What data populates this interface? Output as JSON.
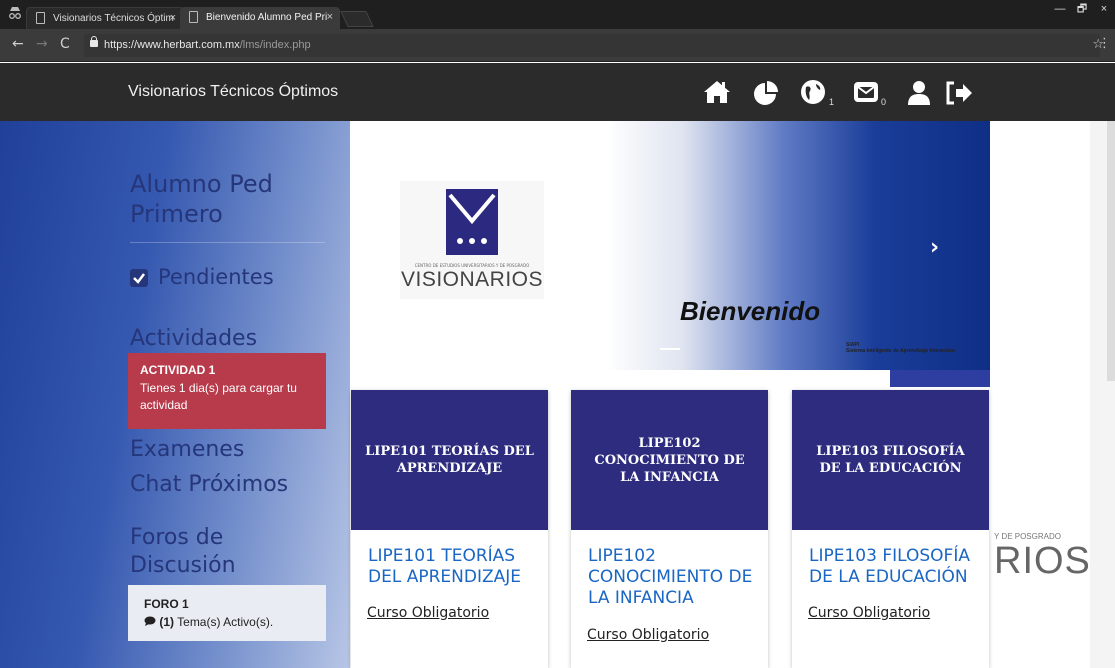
{
  "browser": {
    "tabs": [
      {
        "title": "Visionarios Técnicos Óptim",
        "active": false
      },
      {
        "title": "Bienvenido Alumno Ped Pri",
        "active": true
      }
    ],
    "url_host": "https://www.herbart.com.mx",
    "url_path": "/lms/index.php",
    "window_controls": {
      "minimize": "—",
      "restore": "🗗",
      "close": "×"
    },
    "tab_close": "×"
  },
  "header": {
    "brand": "Visionarios Técnicos Óptimos",
    "globe_count": "1",
    "mail_count": "0",
    "icons": [
      "home-icon",
      "pie-chart-icon",
      "globe-icon",
      "envelope-icon",
      "user-icon",
      "sign-out-icon"
    ]
  },
  "sidebar": {
    "student_name": "Alumno Ped Primero",
    "pendientes_label": "Pendientes",
    "actividades_heading": "Actividades",
    "activity_alert": {
      "title": "ACTIVIDAD 1",
      "message": "Tienes 1 dia(s) para cargar tu actividad"
    },
    "examenes_label": "Examenes",
    "chat_label": "Chat Próximos",
    "foros_heading": "Foros de Discusión",
    "forum": {
      "title": "FORO 1",
      "count": "(1)",
      "message": "Tema(s) Activo(s)."
    }
  },
  "carousel": {
    "logo_text": "VISIONARIOS",
    "logo_subtext": "CENTRO DE ESTUDIOS UNIVERSITARIOS Y DE POSGRADO",
    "welcome": "Bienvenido",
    "siap_title": "SIAPI",
    "siap_subtitle": "Sistema Inteligente de Aprendizaje Interactivo",
    "next_arrow": "›"
  },
  "background_partial": {
    "grado_text": "Y DE POSGRADO",
    "visionarios_partial": "RIOS"
  },
  "courses": [
    {
      "header": "LIPE101 TEORÍAS DEL APRENDIZAJE",
      "title": "LIPE101 TEORÍAS DEL APRENDIZAJE",
      "tag": "Curso Obligatorio"
    },
    {
      "header": "LIPE102 CONOCIMIENTO DE LA INFANCIA",
      "title": "LIPE102 CONOCIMIENTO DE LA INFANCIA",
      "tag": "Curso Obligatorio"
    },
    {
      "header": "LIPE103 FILOSOFÍA DE LA EDUCACIÓN",
      "title": "LIPE103 FILOSOFÍA DE LA EDUCACIÓN",
      "tag": "Curso Obligatorio"
    }
  ],
  "colors": {
    "alert": "#b73b4b",
    "card_header": "#2e2c7e",
    "link": "#1a66c4",
    "sidebar_text": "#26367a"
  }
}
